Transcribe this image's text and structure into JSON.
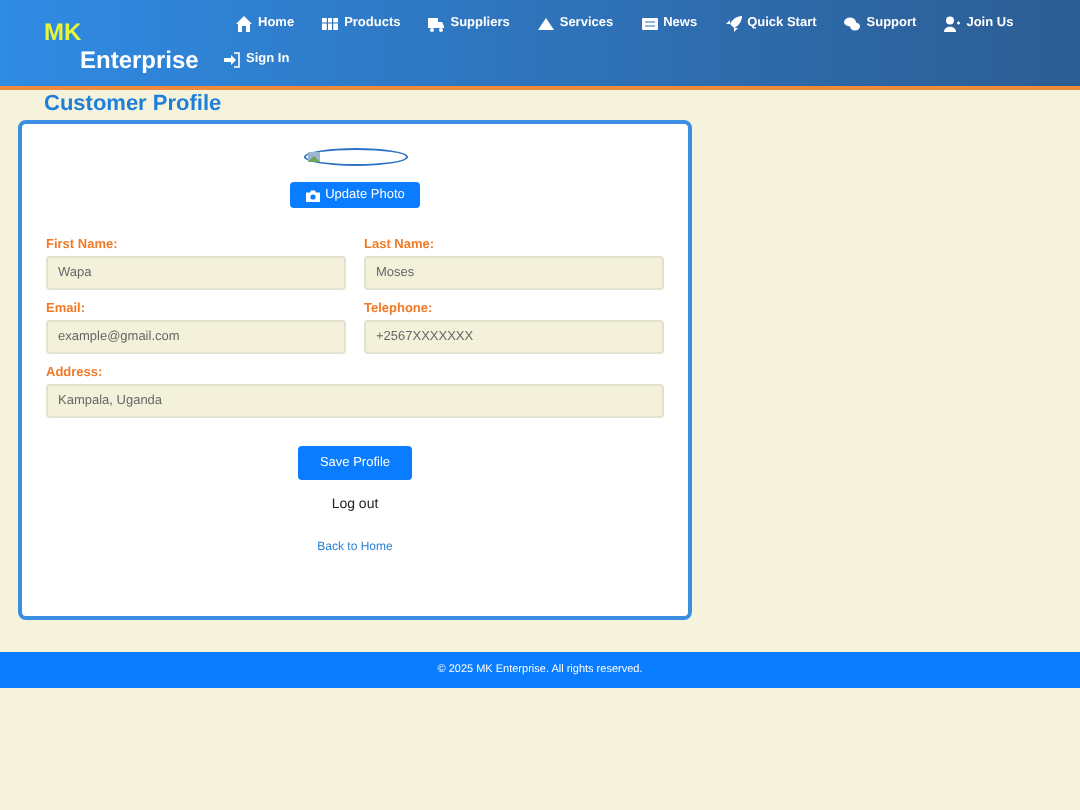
{
  "header": {
    "logo_top": "MK",
    "logo_bottom": "Enterprise",
    "nav": [
      {
        "label": "Home",
        "kind": "home"
      },
      {
        "label": "Products",
        "kind": "grid"
      },
      {
        "label": "Suppliers",
        "kind": "truck"
      },
      {
        "label": "Services",
        "kind": "triangle"
      },
      {
        "label": "News",
        "kind": "paper"
      },
      {
        "label": "Quick Start",
        "kind": "rocket"
      },
      {
        "label": "Support",
        "kind": "chat"
      },
      {
        "label": "Join Us",
        "kind": "user"
      },
      {
        "label": "Sign In",
        "kind": "signin"
      }
    ]
  },
  "page_title": "Customer Profile",
  "profile": {
    "photo_button": "Update Photo",
    "fields": [
      {
        "label": "First Name:",
        "value": "Wapa"
      },
      {
        "label": "Last Name:",
        "value": "Moses"
      },
      {
        "label": "Email:",
        "value": "example@gmail.com"
      },
      {
        "label": "Telephone:",
        "value": "+2567XXXXXXX"
      },
      {
        "label": "Address:",
        "value": "Kampala, Uganda",
        "wide": true
      }
    ],
    "save_button": "Save Profile",
    "logout": "Log out",
    "back_link": "Back to Home"
  },
  "footer": "© 2025 MK Enterprise. All rights reserved."
}
